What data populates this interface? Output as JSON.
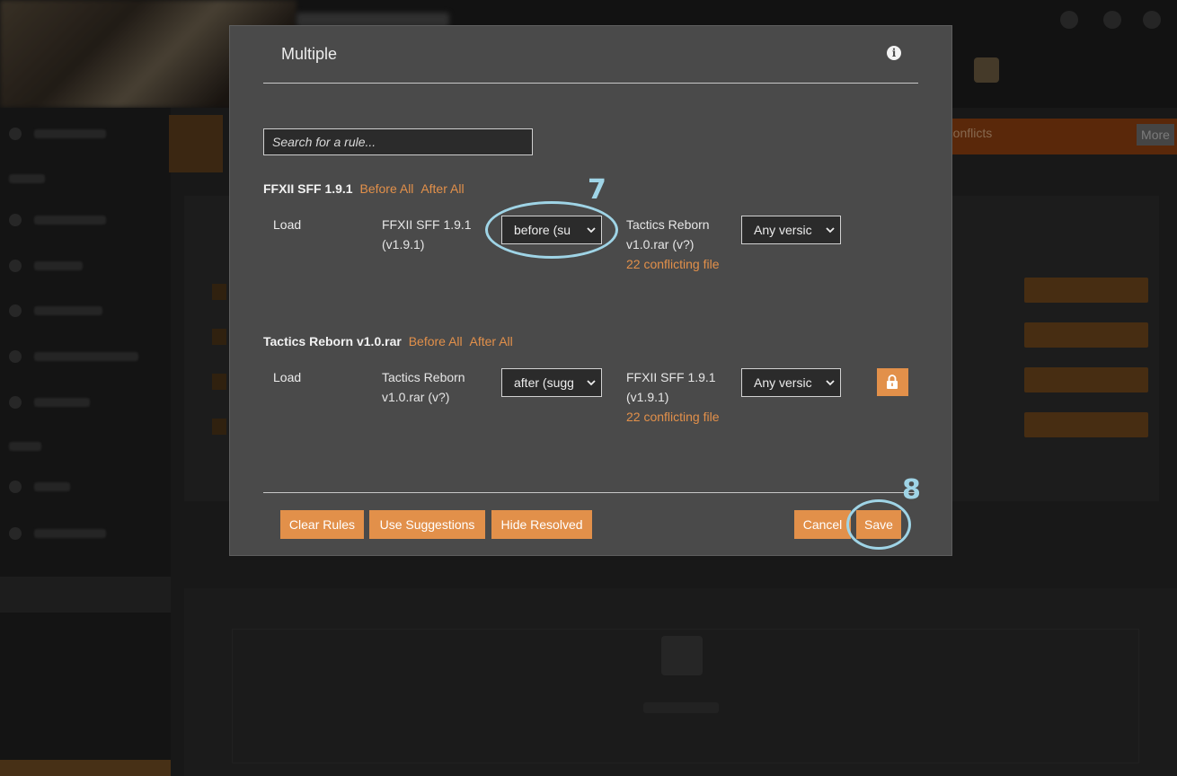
{
  "background": {
    "banner_text": "e conflicts",
    "more_button": "More"
  },
  "dialog": {
    "title": "Multiple",
    "info_icon": "info-icon",
    "search_placeholder": "Search for a rule...",
    "groups": [
      {
        "name": "FFXII SFF 1.9.1",
        "before_all": "Before All",
        "after_all": "After All",
        "rule": {
          "type": "Load",
          "source": "FFXII SFF 1.9.1 (v1.9.1)",
          "direction": "before (su",
          "target": "Tactics Reborn v1.0.rar (v?)",
          "conflicts": "22 conflicting file",
          "version": "Any versic"
        }
      },
      {
        "name": "Tactics Reborn v1.0.rar",
        "before_all": "Before All",
        "after_all": "After All",
        "rule": {
          "type": "Load",
          "source": "Tactics Reborn v1.0.rar (v?)",
          "direction": "after (sugg",
          "target": "FFXII SFF 1.9.1 (v1.9.1)",
          "conflicts": "22 conflicting file",
          "version": "Any versic",
          "lock_icon": "lock-icon"
        }
      }
    ],
    "footer": {
      "clear_rules": "Clear Rules",
      "use_suggestions": "Use Suggestions",
      "hide_resolved": "Hide Resolved",
      "cancel": "Cancel",
      "save": "Save"
    }
  },
  "annotations": {
    "step_7": "7",
    "step_8": "8",
    "color": "#9fd4e6"
  },
  "colors": {
    "accent": "#e2904a",
    "dialog_bg": "#4a4a4a",
    "field_bg": "#2b2b2b"
  }
}
